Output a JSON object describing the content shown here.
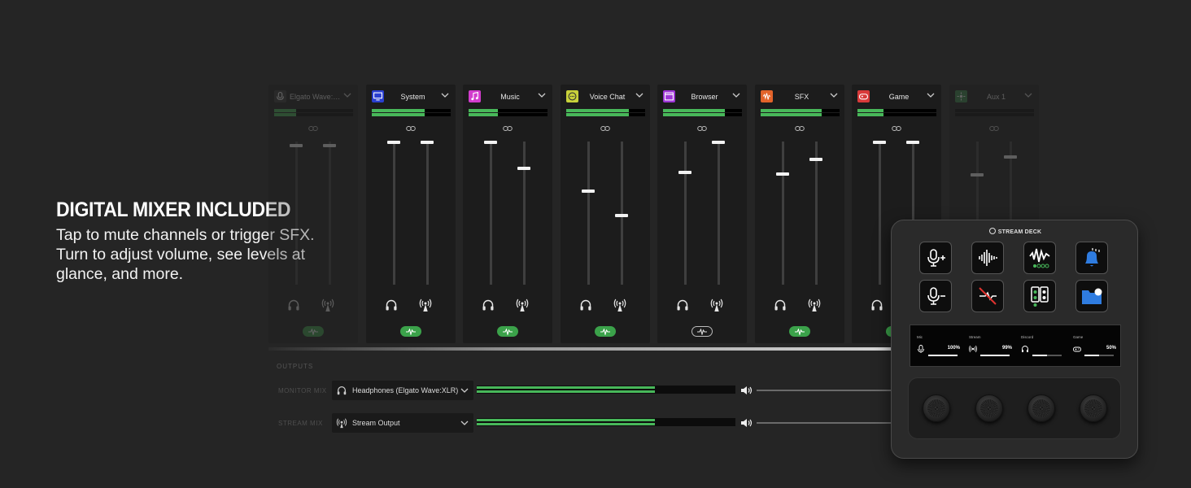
{
  "promo": {
    "headline": "DIGITAL MIXER INCLUDED",
    "body": "Tap to mute channels or trigger SFX. Turn to adjust volume, see levels at glance, and more."
  },
  "channels": [
    {
      "name": "Elgato Wave:XLR",
      "icon": "mic-icon",
      "color": "#3a3a3a",
      "faded": true,
      "meter": [
        0.28,
        0.28
      ],
      "faders": [
        0.98,
        0.98
      ],
      "pill": "fill"
    },
    {
      "name": "System",
      "icon": "monitor-icon",
      "color": "#2a3fcf",
      "faded": false,
      "meter": [
        0.68,
        0.68
      ],
      "faders": [
        1.0,
        1.0
      ],
      "pill": "fill"
    },
    {
      "name": "Music",
      "icon": "music-note-icon",
      "color": "#d23ccd",
      "faded": false,
      "meter": [
        0.37,
        0.37
      ],
      "faders": [
        1.0,
        0.82
      ],
      "pill": "fill"
    },
    {
      "name": "Voice Chat",
      "icon": "chat-icon",
      "color": "#c8d13a",
      "faded": false,
      "meter": [
        0.8,
        0.8
      ],
      "faders": [
        0.66,
        0.49
      ],
      "pill": "fill"
    },
    {
      "name": "Browser",
      "icon": "browser-icon",
      "color": "#9e35d6",
      "faded": false,
      "meter": [
        0.78,
        0.78
      ],
      "faders": [
        0.79,
        1.0
      ],
      "pill": "outline"
    },
    {
      "name": "SFX",
      "icon": "waveform-icon",
      "color": "#e2632a",
      "faded": false,
      "meter": [
        0.78,
        0.78
      ],
      "faders": [
        0.78,
        0.88
      ],
      "pill": "fill"
    },
    {
      "name": "Game",
      "icon": "gamepad-icon",
      "color": "#d83a3a",
      "faded": false,
      "meter": [
        0.33,
        0.33
      ],
      "faders": [
        1.0,
        1.0
      ],
      "pill": "fill"
    },
    {
      "name": "Aux 1",
      "icon": "aux-icon",
      "color": "#3a8a4a",
      "faded": true,
      "meter": [
        0.0,
        0.0
      ],
      "faders": [
        0.77,
        0.9
      ],
      "pill": "none"
    }
  ],
  "outputs": {
    "label": "OUTPUTS",
    "rows": [
      {
        "label": "MONITOR MIX",
        "device": "Headphones (Elgato Wave:XLR)",
        "icon": "headphones-icon",
        "level": 0.69
      },
      {
        "label": "STREAM MIX",
        "device": "Stream Output",
        "icon": "broadcast-icon",
        "level": 0.69
      }
    ]
  },
  "deck": {
    "brand": "STREAM DECK",
    "keys": [
      "mic-plus-icon",
      "voice-wave-icon",
      "waveform-level-icon",
      "bell-icon",
      "mic-minus-icon",
      "mute-slash-icon",
      "speaker-toggle-icon",
      "folder-icon"
    ],
    "lcd": [
      {
        "label": "Mic",
        "value": "100%",
        "level": 1.0,
        "icon": "mic-icon"
      },
      {
        "label": "Stream",
        "value": "99%",
        "level": 0.99,
        "icon": "broadcast-icon"
      },
      {
        "label": "Discord",
        "value": "",
        "level": 0.5,
        "icon": "headphones-icon"
      },
      {
        "label": "Game",
        "value": "50%",
        "level": 0.5,
        "icon": "gamepad-icon"
      }
    ]
  }
}
